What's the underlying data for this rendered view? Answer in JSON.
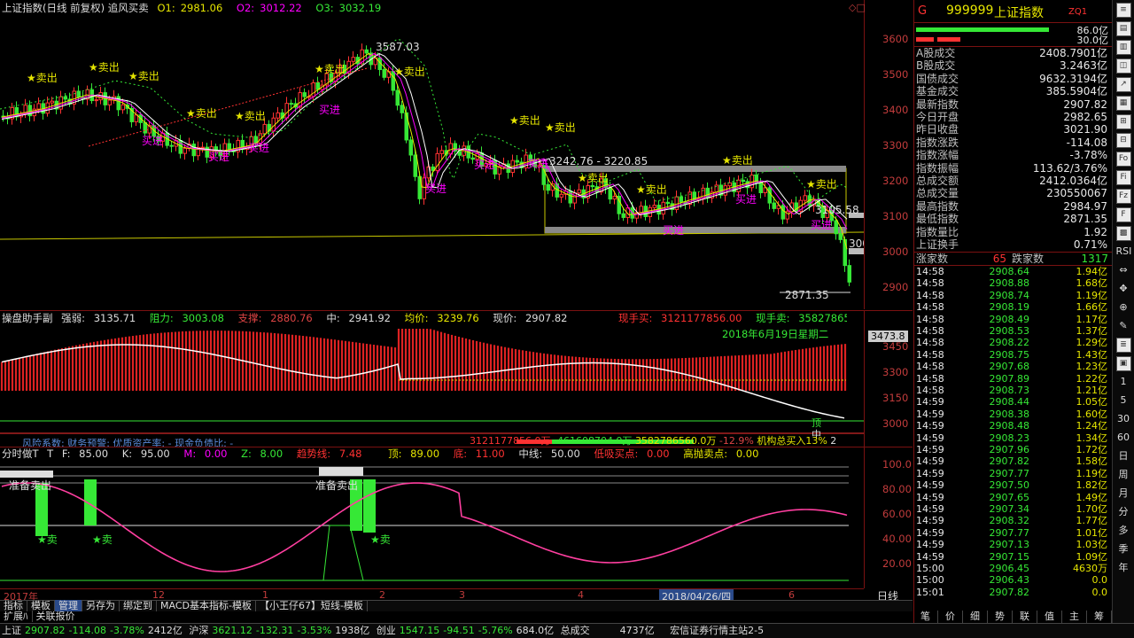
{
  "main_chart": {
    "title": "上证指数(日线 前复权) 追风买卖",
    "o1_label": "O1:",
    "o1": "2981.06",
    "o2_label": "O2:",
    "o2": "3012.22",
    "o3_label": "O3:",
    "o3": "3032.19",
    "hi_label": "3587.03",
    "lo_label": "2871.35",
    "box_label": "3242.76 - 3220.85",
    "box2_label": "3105.58",
    "right_label": "3000",
    "sell_label": "卖出",
    "buy_label": "买进",
    "y_ticks": [
      "3600",
      "3500",
      "3400",
      "3300",
      "3200",
      "3100",
      "3000",
      "2900"
    ]
  },
  "sub1": {
    "title": "操盘助手副",
    "strength_label": "强弱:",
    "strength": "3135.71",
    "resist_label": "阻力:",
    "resist": "3003.08",
    "support_label": "支撑:",
    "support": "2880.76",
    "mid_label": "中:",
    "mid": "2941.92",
    "avg_label": "均价:",
    "avg": "3239.76",
    "now_label": "现价:",
    "now": "2907.82",
    "hand_buy_label": "现手买:",
    "hand_buy": "3121177856.00",
    "hand_sell_label": "现手卖:",
    "hand_sell": "3582786560",
    "date_label": "2018年6月19日星期二",
    "price_tag": "3473.8",
    "y_ticks": [
      "3450",
      "3300",
      "3150",
      "3000"
    ],
    "top_label": "顶",
    "mid2_label": "中",
    "bottom_text": "风险系数: 财务预警: 优质资产率: - 现金负债比: -",
    "bottom_v1": "3121177856.0万",
    "bottom_v2": "-461608704.0万",
    "bottom_v3": "3582786560.0万",
    "bottom_pct": "-12.9%",
    "inst_label": "机构总买入",
    "inst_pct": "13%",
    "end_label": "2"
  },
  "sub2": {
    "title": "分时做T",
    "f_label": "F:",
    "f": "85.00",
    "k_label": "K:",
    "k": "95.00",
    "m_label": "M:",
    "m": "0.00",
    "z_label": "Z:",
    "z": "8.00",
    "trend_label": "趋势线:",
    "trend": "7.48",
    "top_label": "顶:",
    "top": "89.00",
    "bot_label": "底:",
    "bot": "11.00",
    "midline_label": "中线:",
    "midline": "50.00",
    "low_buy_label": "低吸买点:",
    "low_buy": "0.00",
    "high_sell_label": "高抛卖点:",
    "high_sell": "0.00",
    "ready_sell": "准备卖出",
    "sell_star": "卖",
    "y_ticks": [
      "100.0",
      "80.00",
      "60.00",
      "40.00",
      "20.00"
    ]
  },
  "time_axis": {
    "labels": [
      "2017年",
      "12",
      "1",
      "2",
      "3",
      "4",
      "5",
      "6"
    ],
    "cursor_date": "2018/04/26/四",
    "period": "日线"
  },
  "bottom_tabs": [
    "指标",
    "模板",
    "管理",
    "另存为",
    "绑定到",
    "MACD基本指标-模板",
    "【小王仔67】短线-模板"
  ],
  "bottom_tabs2": [
    "扩展ﾊ",
    "关联报价"
  ],
  "right_panel": {
    "g": "G",
    "code": "999999",
    "name": "上证指数",
    "zq": "ZQ1",
    "bar1_val": "86.0亿",
    "bar2_val": "30.0亿",
    "stats": [
      {
        "label": "A股成交",
        "value": "2408.7901亿"
      },
      {
        "label": "B股成交",
        "value": "3.2463亿"
      },
      {
        "label": "国债成交",
        "value": "9632.3194亿"
      },
      {
        "label": "基金成交",
        "value": "385.5904亿"
      },
      {
        "label": "最新指数",
        "value": "2907.82"
      },
      {
        "label": "今日开盘",
        "value": "2982.65"
      },
      {
        "label": "昨日收盘",
        "value": "3021.90"
      },
      {
        "label": "指数涨跌",
        "value": "-114.08"
      },
      {
        "label": "指数涨幅",
        "value": "-3.78%"
      },
      {
        "label": "指数振幅",
        "value": "113.62/3.76%"
      },
      {
        "label": "总成交额",
        "value": "2412.0364亿"
      },
      {
        "label": "总成交量",
        "value": "230550067"
      },
      {
        "label": "最高指数",
        "value": "2984.97"
      },
      {
        "label": "最低指数",
        "value": "2871.35"
      },
      {
        "label": "指数量比",
        "value": "1.92"
      },
      {
        "label": "上证换手",
        "value": "0.71%"
      }
    ],
    "up_label": "涨家数",
    "up": "65",
    "down_label": "跌家数",
    "down": "1317",
    "ticks": [
      {
        "t": "14:58",
        "p": "2908.64",
        "v": "1.94亿"
      },
      {
        "t": "14:58",
        "p": "2908.88",
        "v": "1.68亿"
      },
      {
        "t": "14:58",
        "p": "2908.74",
        "v": "1.19亿"
      },
      {
        "t": "14:58",
        "p": "2908.19",
        "v": "1.66亿"
      },
      {
        "t": "14:58",
        "p": "2908.49",
        "v": "1.17亿"
      },
      {
        "t": "14:58",
        "p": "2908.53",
        "v": "1.37亿"
      },
      {
        "t": "14:58",
        "p": "2908.22",
        "v": "1.29亿"
      },
      {
        "t": "14:58",
        "p": "2908.75",
        "v": "1.43亿"
      },
      {
        "t": "14:58",
        "p": "2907.68",
        "v": "1.23亿"
      },
      {
        "t": "14:58",
        "p": "2907.89",
        "v": "1.22亿"
      },
      {
        "t": "14:58",
        "p": "2908.73",
        "v": "1.21亿"
      },
      {
        "t": "14:59",
        "p": "2908.44",
        "v": "1.05亿"
      },
      {
        "t": "14:59",
        "p": "2908.38",
        "v": "1.60亿"
      },
      {
        "t": "14:59",
        "p": "2908.48",
        "v": "1.24亿"
      },
      {
        "t": "14:59",
        "p": "2908.23",
        "v": "1.34亿"
      },
      {
        "t": "14:59",
        "p": "2907.96",
        "v": "1.72亿"
      },
      {
        "t": "14:59",
        "p": "2907.82",
        "v": "1.58亿"
      },
      {
        "t": "14:59",
        "p": "2907.77",
        "v": "1.19亿"
      },
      {
        "t": "14:59",
        "p": "2907.50",
        "v": "1.82亿"
      },
      {
        "t": "14:59",
        "p": "2907.65",
        "v": "1.49亿"
      },
      {
        "t": "14:59",
        "p": "2907.34",
        "v": "1.70亿"
      },
      {
        "t": "14:59",
        "p": "2908.32",
        "v": "1.77亿"
      },
      {
        "t": "14:59",
        "p": "2907.77",
        "v": "1.01亿"
      },
      {
        "t": "14:59",
        "p": "2907.13",
        "v": "1.03亿"
      },
      {
        "t": "14:59",
        "p": "2907.15",
        "v": "1.09亿"
      },
      {
        "t": "15:00",
        "p": "2906.45",
        "v": "4630万"
      },
      {
        "t": "15:00",
        "p": "2906.43",
        "v": "0.0"
      },
      {
        "t": "15:01",
        "p": "2907.82",
        "v": "0.0"
      }
    ],
    "tabs": [
      "笔",
      "价",
      "细",
      "势",
      "联",
      "值",
      "主",
      "筹"
    ]
  },
  "toolbar_right": [
    "周",
    "月",
    "分",
    "多",
    "季",
    "年"
  ],
  "status_bar": {
    "sh_label": "上证",
    "sh_price": "2907.82",
    "sh_chg": "-114.08",
    "sh_pct": "-3.78%",
    "sh_amt": "2412亿",
    "hs_label": "沪深",
    "hs_price": "3621.12",
    "hs_chg": "-132.31",
    "hs_pct": "-3.53%",
    "hs_amt": "1938亿",
    "cy_label": "创业",
    "cy_price": "1547.15",
    "cy_chg": "-94.51",
    "cy_pct": "-5.76%",
    "cy_amt": "684.0亿",
    "total_label": "总成交",
    "total": "4737亿",
    "broker": "宏信证券行情主站2-5"
  },
  "colors": {
    "up": "#ff3232",
    "down": "#36e836",
    "grid": "#7a1111",
    "accent": "#e6e600"
  }
}
